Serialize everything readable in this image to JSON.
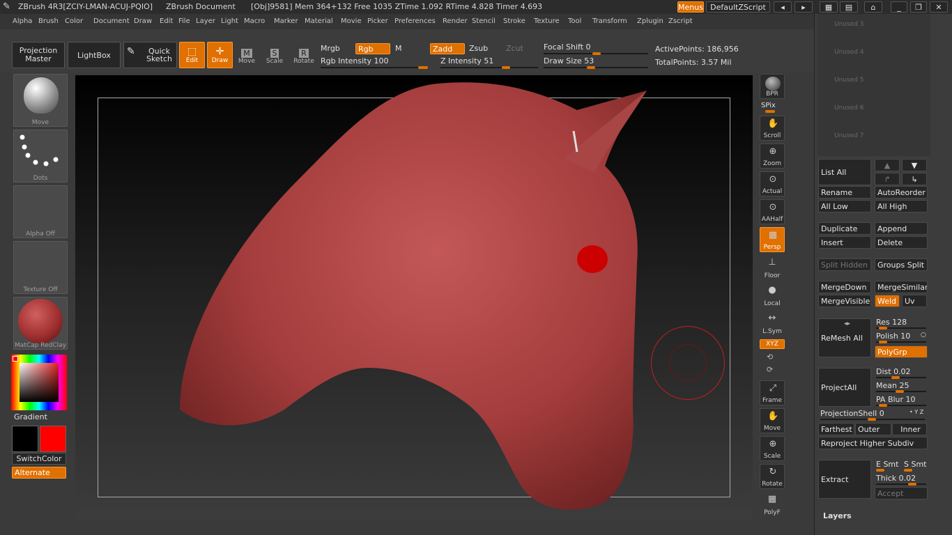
{
  "titlebar": {
    "app": "ZBrush 4R3[ZCIY-LMAN-ACUJ-PQIO]",
    "doc": "ZBrush Document",
    "stats": "[Obj]9581] Mem 364+132 Free 1035 ZTime 1.092 RTime 4.828 Timer 4.693",
    "menus_btn": "Menus",
    "script_btn": "DefaultZScript"
  },
  "menu": [
    "Alpha",
    "Brush",
    "Color",
    "Document",
    "Draw",
    "Edit",
    "File",
    "Layer",
    "Light",
    "Macro",
    "Marker",
    "Material",
    "Movie",
    "Picker",
    "Preferences",
    "Render",
    "Stencil",
    "Stroke",
    "Texture",
    "Tool",
    "Transform",
    "Zplugin",
    "Zscript"
  ],
  "toolbar": {
    "projection_master": "Projection Master",
    "lightbox": "LightBox",
    "quick_sketch": "Quick Sketch",
    "edit": "Edit",
    "draw": "Draw",
    "move": "Move",
    "scale": "Scale",
    "rotate": "Rotate",
    "mrgb": "Mrgb",
    "rgb": "Rgb",
    "m": "M",
    "zadd": "Zadd",
    "zsub": "Zsub",
    "zcut": "Zcut",
    "rgb_intensity": "Rgb Intensity 100",
    "z_intensity": "Z Intensity 51",
    "focal_shift": "Focal Shift 0",
    "draw_size": "Draw Size 53",
    "active_points": "ActivePoints: 186,956",
    "total_points": "TotalPoints: 3.57 Mil"
  },
  "left": {
    "brush": "Move",
    "stroke": "Dots",
    "alpha": "Alpha Off",
    "texture": "Texture Off",
    "material": "MatCap RedClay",
    "gradient": "Gradient",
    "switchcolor": "SwitchColor",
    "alternate": "Alternate"
  },
  "right_tools": [
    "BPR",
    "SPix",
    "Scroll",
    "Zoom",
    "Actual",
    "AAHalf",
    "Persp",
    "Floor",
    "Local",
    "L.Sym",
    "XYZ",
    "Frame",
    "Move",
    "Scale",
    "Rotate",
    "PolyF"
  ],
  "subtool": {
    "unused": [
      "Unused 3",
      "Unused 4",
      "Unused 5",
      "Unused 6",
      "Unused 7"
    ],
    "list_all": "List All",
    "rename": "Rename",
    "autoreorder": "AutoReorder",
    "all_low": "All Low",
    "all_high": "All High",
    "duplicate": "Duplicate",
    "append": "Append",
    "insert": "Insert",
    "delete": "Delete",
    "split_hidden": "Split Hidden",
    "groups_split": "Groups Split",
    "mergedown": "MergeDown",
    "mergesimilar": "MergeSimilar",
    "mergevisible": "MergeVisible",
    "weld": "Weld",
    "uv": "Uv",
    "remesh_all": "ReMesh All",
    "res": "Res 128",
    "polish": "Polish 10",
    "polygrp": "PolyGrp",
    "projectall": "ProjectAll",
    "dist": "Dist 0.02",
    "mean": "Mean 25",
    "pa_blur": "PA Blur 10",
    "projection_shell": "ProjectionShell 0",
    "xyz_small": "• Y Z",
    "farthest": "Farthest",
    "outer": "Outer",
    "inner": "Inner",
    "reproject": "Reproject Higher Subdiv",
    "extract": "Extract",
    "e_smt": "E Smt",
    "s_smt": "S Smt",
    "thick": "Thick 0.02",
    "accept": "Accept",
    "layers": "Layers"
  }
}
